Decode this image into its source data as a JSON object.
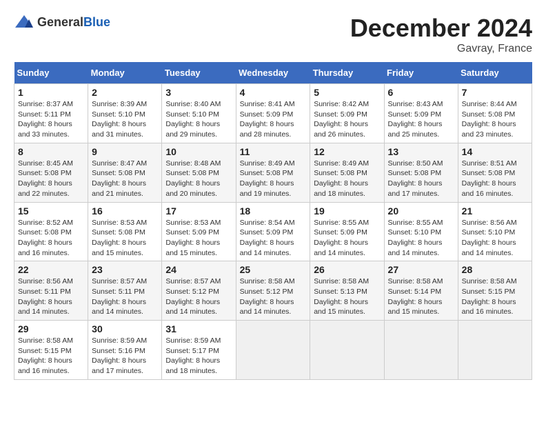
{
  "header": {
    "logo_general": "General",
    "logo_blue": "Blue",
    "month_title": "December 2024",
    "location": "Gavray, France"
  },
  "weekdays": [
    "Sunday",
    "Monday",
    "Tuesday",
    "Wednesday",
    "Thursday",
    "Friday",
    "Saturday"
  ],
  "weeks": [
    [
      {
        "day": "1",
        "sunrise": "8:37 AM",
        "sunset": "5:11 PM",
        "daylight": "8 hours and 33 minutes."
      },
      {
        "day": "2",
        "sunrise": "8:39 AM",
        "sunset": "5:10 PM",
        "daylight": "8 hours and 31 minutes."
      },
      {
        "day": "3",
        "sunrise": "8:40 AM",
        "sunset": "5:10 PM",
        "daylight": "8 hours and 29 minutes."
      },
      {
        "day": "4",
        "sunrise": "8:41 AM",
        "sunset": "5:09 PM",
        "daylight": "8 hours and 28 minutes."
      },
      {
        "day": "5",
        "sunrise": "8:42 AM",
        "sunset": "5:09 PM",
        "daylight": "8 hours and 26 minutes."
      },
      {
        "day": "6",
        "sunrise": "8:43 AM",
        "sunset": "5:09 PM",
        "daylight": "8 hours and 25 minutes."
      },
      {
        "day": "7",
        "sunrise": "8:44 AM",
        "sunset": "5:08 PM",
        "daylight": "8 hours and 23 minutes."
      }
    ],
    [
      {
        "day": "8",
        "sunrise": "8:45 AM",
        "sunset": "5:08 PM",
        "daylight": "8 hours and 22 minutes."
      },
      {
        "day": "9",
        "sunrise": "8:47 AM",
        "sunset": "5:08 PM",
        "daylight": "8 hours and 21 minutes."
      },
      {
        "day": "10",
        "sunrise": "8:48 AM",
        "sunset": "5:08 PM",
        "daylight": "8 hours and 20 minutes."
      },
      {
        "day": "11",
        "sunrise": "8:49 AM",
        "sunset": "5:08 PM",
        "daylight": "8 hours and 19 minutes."
      },
      {
        "day": "12",
        "sunrise": "8:49 AM",
        "sunset": "5:08 PM",
        "daylight": "8 hours and 18 minutes."
      },
      {
        "day": "13",
        "sunrise": "8:50 AM",
        "sunset": "5:08 PM",
        "daylight": "8 hours and 17 minutes."
      },
      {
        "day": "14",
        "sunrise": "8:51 AM",
        "sunset": "5:08 PM",
        "daylight": "8 hours and 16 minutes."
      }
    ],
    [
      {
        "day": "15",
        "sunrise": "8:52 AM",
        "sunset": "5:08 PM",
        "daylight": "8 hours and 16 minutes."
      },
      {
        "day": "16",
        "sunrise": "8:53 AM",
        "sunset": "5:08 PM",
        "daylight": "8 hours and 15 minutes."
      },
      {
        "day": "17",
        "sunrise": "8:53 AM",
        "sunset": "5:09 PM",
        "daylight": "8 hours and 15 minutes."
      },
      {
        "day": "18",
        "sunrise": "8:54 AM",
        "sunset": "5:09 PM",
        "daylight": "8 hours and 14 minutes."
      },
      {
        "day": "19",
        "sunrise": "8:55 AM",
        "sunset": "5:09 PM",
        "daylight": "8 hours and 14 minutes."
      },
      {
        "day": "20",
        "sunrise": "8:55 AM",
        "sunset": "5:10 PM",
        "daylight": "8 hours and 14 minutes."
      },
      {
        "day": "21",
        "sunrise": "8:56 AM",
        "sunset": "5:10 PM",
        "daylight": "8 hours and 14 minutes."
      }
    ],
    [
      {
        "day": "22",
        "sunrise": "8:56 AM",
        "sunset": "5:11 PM",
        "daylight": "8 hours and 14 minutes."
      },
      {
        "day": "23",
        "sunrise": "8:57 AM",
        "sunset": "5:11 PM",
        "daylight": "8 hours and 14 minutes."
      },
      {
        "day": "24",
        "sunrise": "8:57 AM",
        "sunset": "5:12 PM",
        "daylight": "8 hours and 14 minutes."
      },
      {
        "day": "25",
        "sunrise": "8:58 AM",
        "sunset": "5:12 PM",
        "daylight": "8 hours and 14 minutes."
      },
      {
        "day": "26",
        "sunrise": "8:58 AM",
        "sunset": "5:13 PM",
        "daylight": "8 hours and 15 minutes."
      },
      {
        "day": "27",
        "sunrise": "8:58 AM",
        "sunset": "5:14 PM",
        "daylight": "8 hours and 15 minutes."
      },
      {
        "day": "28",
        "sunrise": "8:58 AM",
        "sunset": "5:15 PM",
        "daylight": "8 hours and 16 minutes."
      }
    ],
    [
      {
        "day": "29",
        "sunrise": "8:58 AM",
        "sunset": "5:15 PM",
        "daylight": "8 hours and 16 minutes."
      },
      {
        "day": "30",
        "sunrise": "8:59 AM",
        "sunset": "5:16 PM",
        "daylight": "8 hours and 17 minutes."
      },
      {
        "day": "31",
        "sunrise": "8:59 AM",
        "sunset": "5:17 PM",
        "daylight": "8 hours and 18 minutes."
      },
      null,
      null,
      null,
      null
    ]
  ],
  "labels": {
    "sunrise_prefix": "Sunrise: ",
    "sunset_prefix": "Sunset: ",
    "daylight_prefix": "Daylight: "
  }
}
